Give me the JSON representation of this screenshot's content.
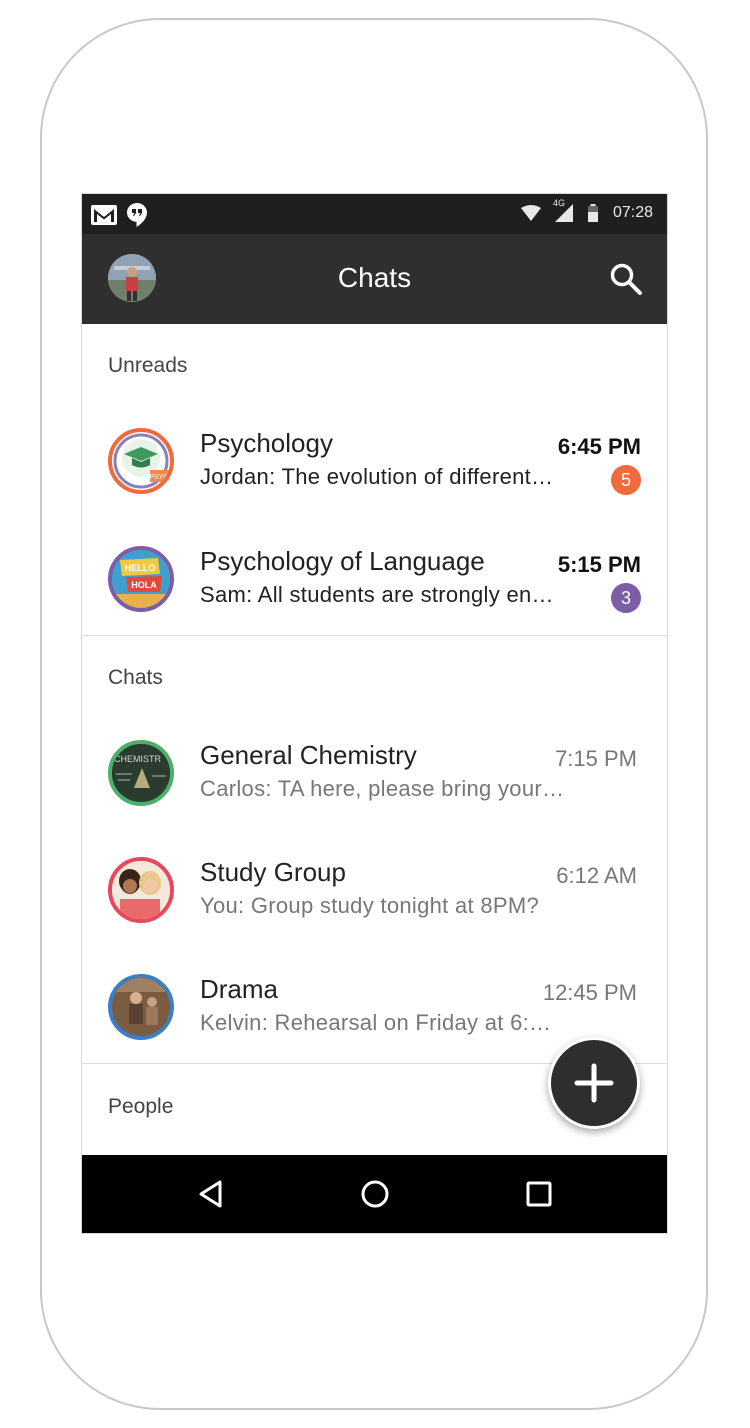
{
  "status_bar": {
    "time": "07:28",
    "network_label": "4G",
    "icons": [
      "gmail-icon",
      "hangouts-icon",
      "wifi-icon",
      "signal-icon",
      "battery-icon"
    ]
  },
  "app_bar": {
    "title": "Chats",
    "left_icon": "profile-avatar",
    "right_icon": "search-icon"
  },
  "sections": {
    "unreads_label": "Unreads",
    "chats_label": "Chats",
    "people_label": "People"
  },
  "unreads": [
    {
      "name": "Psychology",
      "preview": "Jordan: The evolution of different…",
      "time": "6:45 PM",
      "badge": "5",
      "badge_color": "#f06a3c",
      "avatar_text": "PSYC",
      "avatar_ring": "#f06a3c"
    },
    {
      "name": "Psychology of Language",
      "preview": "Sam: All students are strongly en…",
      "time": "5:15 PM",
      "badge": "3",
      "badge_color": "#7b5ea7",
      "avatar_text_top": "HELLO",
      "avatar_text_bottom": "HOLA",
      "avatar_ring": "#7b5ea7"
    }
  ],
  "chats": [
    {
      "name": "General Chemistry",
      "preview": "Carlos: TA here, please bring your…",
      "time": "7:15 PM",
      "avatar_text": "CHEMISTR",
      "avatar_ring": "#4db06a"
    },
    {
      "name": "Study Group",
      "preview": "You: Group study tonight at 8PM?",
      "time": "6:12 AM",
      "avatar_ring": "#e8485a"
    },
    {
      "name": "Drama",
      "preview": "Kelvin: Rehearsal on Friday at 6:…",
      "time": "12:45 PM",
      "avatar_ring": "#3a7fc4"
    }
  ],
  "fab": {
    "icon": "plus-icon"
  },
  "nav_bar": {
    "icons": [
      "back-icon",
      "home-icon",
      "recents-icon"
    ]
  }
}
